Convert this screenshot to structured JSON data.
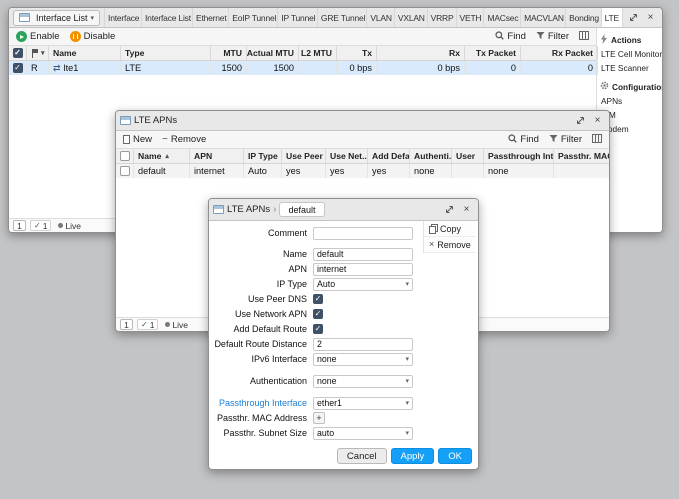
{
  "colors": {
    "accent": "#14a0f6",
    "selected_row": "#d8eafb",
    "checkbox_fill": "#3e5166",
    "modified_label": "#1b7fd4"
  },
  "icons": {
    "caret_down": "▾",
    "sort_asc": "▴",
    "breadcrumb": "›",
    "plus": "+",
    "minus": "−",
    "close": "×",
    "check": "✓",
    "interface": "⇄",
    "live_dot": "●"
  },
  "main_window": {
    "title": "Interface List",
    "tabs": [
      "Interface",
      "Interface List",
      "Ethernet",
      "EoIP Tunnel",
      "IP Tunnel",
      "GRE Tunnel",
      "VLAN",
      "VXLAN",
      "VRRP",
      "VETH",
      "MACsec",
      "MACVLAN",
      "Bonding",
      "LTE"
    ],
    "selected_tab": "LTE",
    "toolbar": {
      "enable": "Enable",
      "disable": "Disable",
      "find": "Find",
      "filter": "Filter"
    },
    "columns": [
      "Name",
      "Type",
      "MTU",
      "Actual MTU",
      "L2 MTU",
      "Tx",
      "Rx",
      "Tx Packet",
      "Rx Packet"
    ],
    "row": {
      "flag": "R",
      "name": "lte1",
      "type": "LTE",
      "mtu": "1500",
      "actual_mtu": "1500",
      "l2_mtu": "",
      "tx": "0 bps",
      "rx": "0 bps",
      "tx_packet": "0",
      "rx_packet": "0"
    },
    "pagination": {
      "page": "1",
      "selected_count": "1",
      "live_label": "Live"
    },
    "sidebar": {
      "actions_title": "Actions",
      "actions": [
        "LTE Cell Monitor",
        "LTE Scanner"
      ],
      "config_title": "Configuration",
      "config": [
        "APNs",
        "SIM",
        "Modem"
      ]
    }
  },
  "apns_window": {
    "title": "LTE APNs",
    "toolbar": {
      "new": "New",
      "remove": "Remove",
      "find": "Find",
      "filter": "Filter"
    },
    "columns": [
      "Name",
      "APN",
      "IP Type",
      "Use Peer ...",
      "Use Net...",
      "Add Defa...",
      "Authenti...",
      "User",
      "Passthrough Interf...",
      "Passthr. MAC A..."
    ],
    "row": {
      "name": "default",
      "apn": "internet",
      "ip_type": "Auto",
      "use_peer_dns": "yes",
      "use_network_apn": "yes",
      "add_default_route": "yes",
      "authentication": "none",
      "user": "",
      "passthrough_interface": "none",
      "passthr_mac": ""
    },
    "pagination": {
      "page": "1",
      "selected_count": "1",
      "live_label": "Live"
    }
  },
  "detail_window": {
    "title": "LTE APNs",
    "tab": "default",
    "actions": {
      "copy": "Copy",
      "remove": "Remove"
    },
    "fields": {
      "comment": {
        "label": "Comment",
        "value": ""
      },
      "name": {
        "label": "Name",
        "value": "default"
      },
      "apn": {
        "label": "APN",
        "value": "internet"
      },
      "ip_type": {
        "label": "IP Type",
        "value": "Auto"
      },
      "use_peer_dns": {
        "label": "Use Peer DNS",
        "state": "✓"
      },
      "use_network_apn": {
        "label": "Use Network APN",
        "state": "✓"
      },
      "add_default_route": {
        "label": "Add Default Route",
        "state": "✓"
      },
      "default_route_distance": {
        "label": "Default Route Distance",
        "value": "2"
      },
      "ipv6_interface": {
        "label": "IPv6 Interface",
        "value": "none"
      },
      "authentication": {
        "label": "Authentication",
        "value": "none"
      },
      "passthrough_interface": {
        "label": "Passthrough Interface",
        "value": "ether1",
        "modified": true
      },
      "passthr_mac_address": {
        "label": "Passthr. MAC Address",
        "add_button": "+"
      },
      "passthr_subnet_size": {
        "label": "Passthr. Subnet Size",
        "value": "auto"
      }
    },
    "buttons": {
      "cancel": "Cancel",
      "apply": "Apply",
      "ok": "OK"
    }
  }
}
